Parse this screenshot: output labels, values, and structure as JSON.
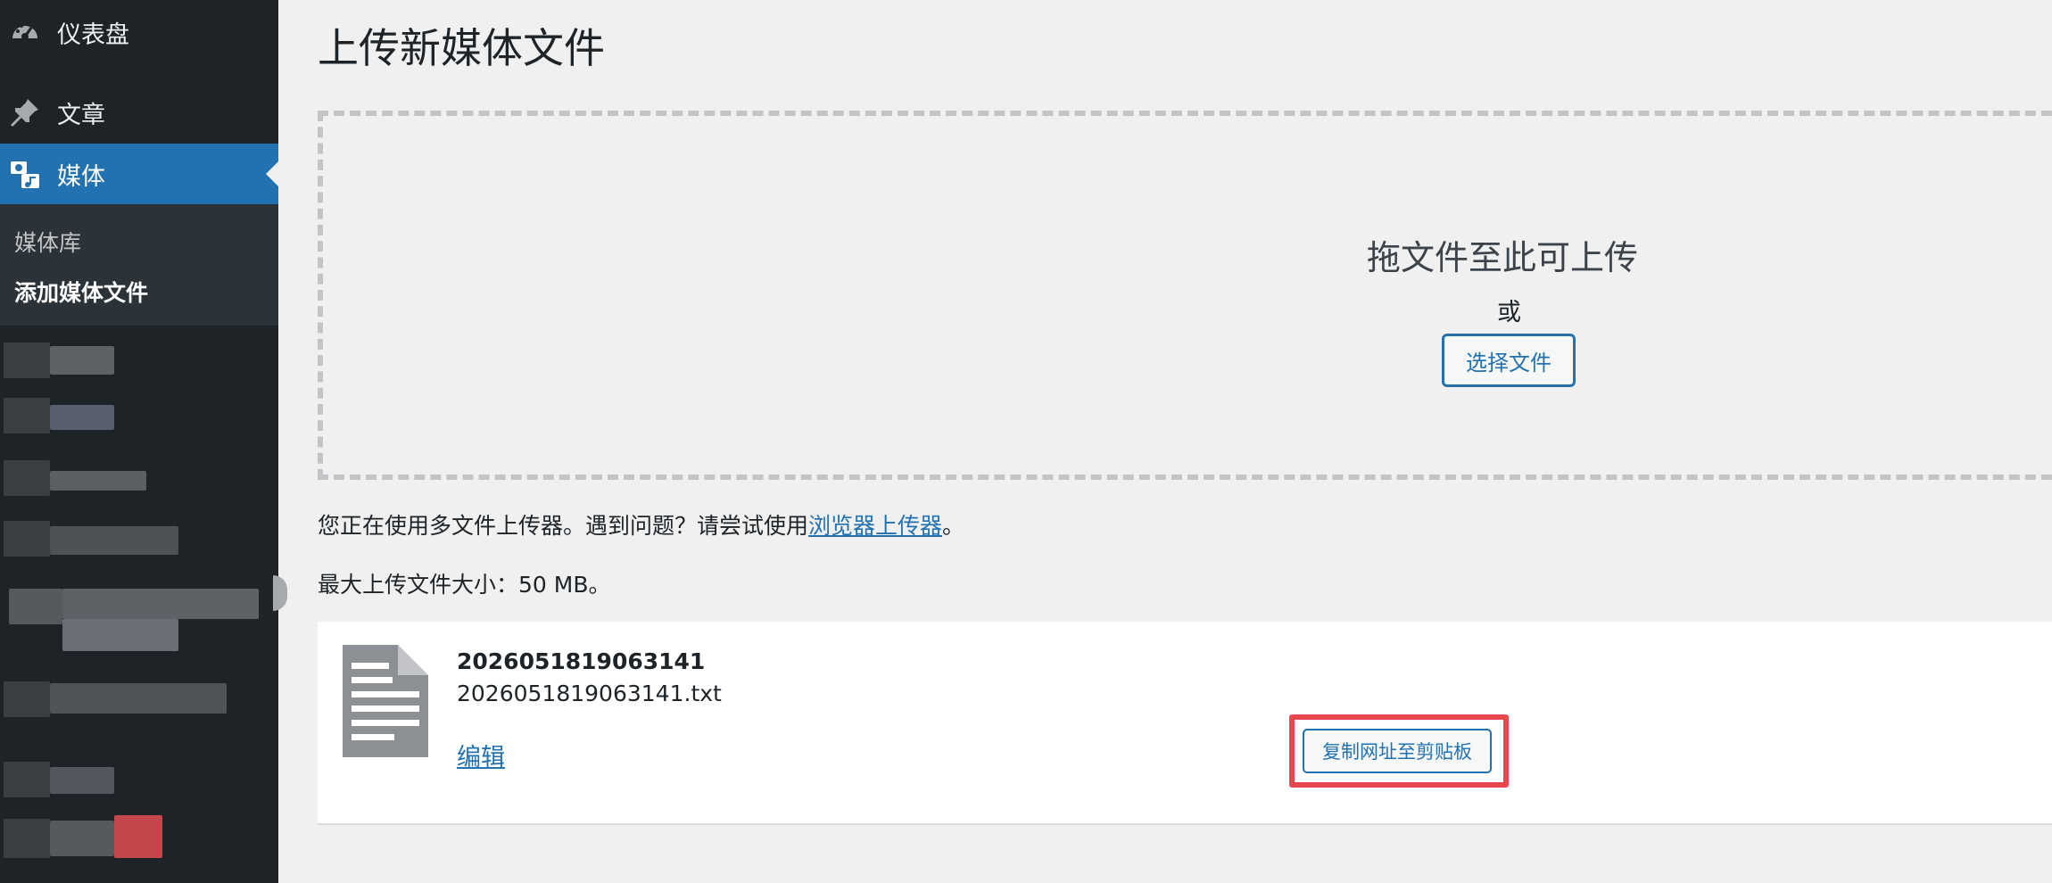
{
  "sidebar": {
    "dashboard_label": "仪表盘",
    "posts_label": "文章",
    "media_label": "媒体",
    "submenu": {
      "library_label": "媒体库",
      "add_new_label": "添加媒体文件"
    },
    "icons": {
      "dashboard": "dashboard-icon",
      "posts": "pin-icon",
      "media": "media-icon"
    },
    "active_color": "#2271b1"
  },
  "main": {
    "page_title": "上传新媒体文件",
    "dropzone": {
      "instructions": "拖文件至此可上传",
      "or_text": "或",
      "select_button": "选择文件"
    },
    "uploader_note": {
      "text": "您正在使用多文件上传器。遇到问题？请尝试使用",
      "link": "浏览器上传器",
      "suffix": "。"
    },
    "max_size": "最大上传文件大小：50 MB。",
    "media_item": {
      "title": "2026051819063141",
      "filename": "2026051819063141.txt",
      "edit_link": "编辑",
      "copy_button": "复制网址至剪贴板",
      "icon": "document-icon"
    }
  },
  "colors": {
    "link": "#2271b1",
    "highlight": "#e9474e",
    "sidebar_bg": "#1d2327"
  }
}
